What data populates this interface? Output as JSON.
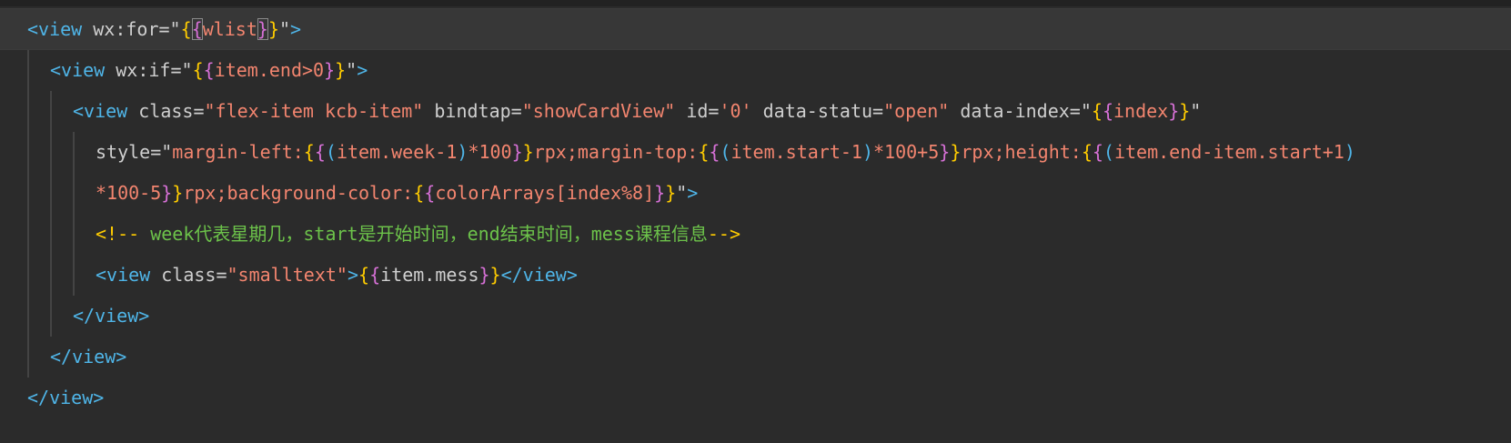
{
  "code": {
    "line1": {
      "open": "<view",
      "attr": " wx:for=",
      "q1": "\"",
      "b1": "{",
      "b2": "{",
      "expr": "wlist",
      "b3": "}",
      "b4": "}",
      "q2": "\"",
      "close": ">"
    },
    "line2": {
      "open": "<view",
      "attr": " wx:if=",
      "q1": "\"",
      "b1": "{",
      "b2": "{",
      "expr": "item.end>0",
      "b3": "}",
      "b4": "}",
      "q2": "\"",
      "close": ">"
    },
    "line3": {
      "open": "<view",
      "attr1": " class=",
      "val1": "\"flex-item kcb-item\"",
      "attr2": " bindtap=",
      "val2": "\"showCardView\"",
      "attr3": " id=",
      "val3": "'0'",
      "attr4": " data-statu=",
      "val4": "\"open\"",
      "attr5": " data-index=",
      "q1": "\"",
      "b1": "{",
      "b2": "{",
      "expr": "index",
      "b3": "}",
      "b4": "}",
      "q2": "\""
    },
    "line4": {
      "attr": "style=",
      "q1": "\"",
      "s1": "margin-left:",
      "b1": "{",
      "b2": "{",
      "p1": "(",
      "e1": "item.week-1",
      "p2": ")",
      "e2": "*100",
      "b3": "}",
      "b4": "}",
      "s2": "rpx;margin-top:",
      "b5": "{",
      "b6": "{",
      "p3": "(",
      "e3": "item.start-1",
      "p4": ")",
      "e4": "*100+5",
      "b7": "}",
      "b8": "}",
      "s3": "rpx;height:",
      "b9": "{",
      "b10": "{",
      "p5": "(",
      "e5": "item.end-item.start+1",
      "p6": ")"
    },
    "line5": {
      "e1": "*100-5",
      "b1": "}",
      "b2": "}",
      "s1": "rpx;background-color:",
      "b3": "{",
      "b4": "{",
      "e2": "colorArrays[index%8]",
      "b5": "}",
      "b6": "}",
      "q": "\"",
      "close": ">"
    },
    "line6": {
      "open": "<!--",
      "text": " week代表星期几，start是开始时间，end结束时间，mess课程信息",
      "close": "-->"
    },
    "line7": {
      "open": "<view",
      "attr": " class=",
      "val": "\"smalltext\"",
      "gt": ">",
      "b1": "{",
      "b2": "{",
      "expr": "item.mess",
      "b3": "}",
      "b4": "}",
      "closeTag": "</view>"
    },
    "line8": {
      "closeTag": "</view>"
    },
    "line9": {
      "closeTag": "</view>"
    },
    "line10": {
      "closeTag": "</view>"
    }
  }
}
